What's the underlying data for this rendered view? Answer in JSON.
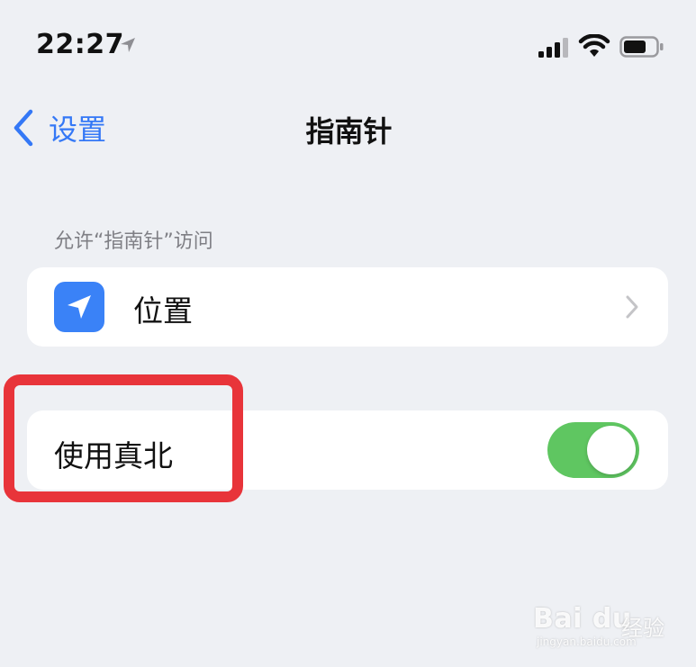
{
  "status_bar": {
    "time": "22:27",
    "icons": [
      "location-arrow-icon",
      "cellular-signal-icon",
      "wifi-icon",
      "battery-icon"
    ]
  },
  "nav": {
    "back_label": "设置",
    "title": "指南针"
  },
  "section": {
    "header": "允许“指南针”访问"
  },
  "location_row": {
    "label": "位置",
    "icon": "location-arrow-icon"
  },
  "true_north_row": {
    "label": "使用真北",
    "toggle_on": true
  },
  "watermark": {
    "logo": "Bai du",
    "sub": "经验",
    "url": "jingyan.baidu.com"
  },
  "colors": {
    "accent_blue": "#3478f6",
    "toggle_green": "#5fc661",
    "highlight_red": "#e8343a",
    "background": "#eef0f4"
  }
}
